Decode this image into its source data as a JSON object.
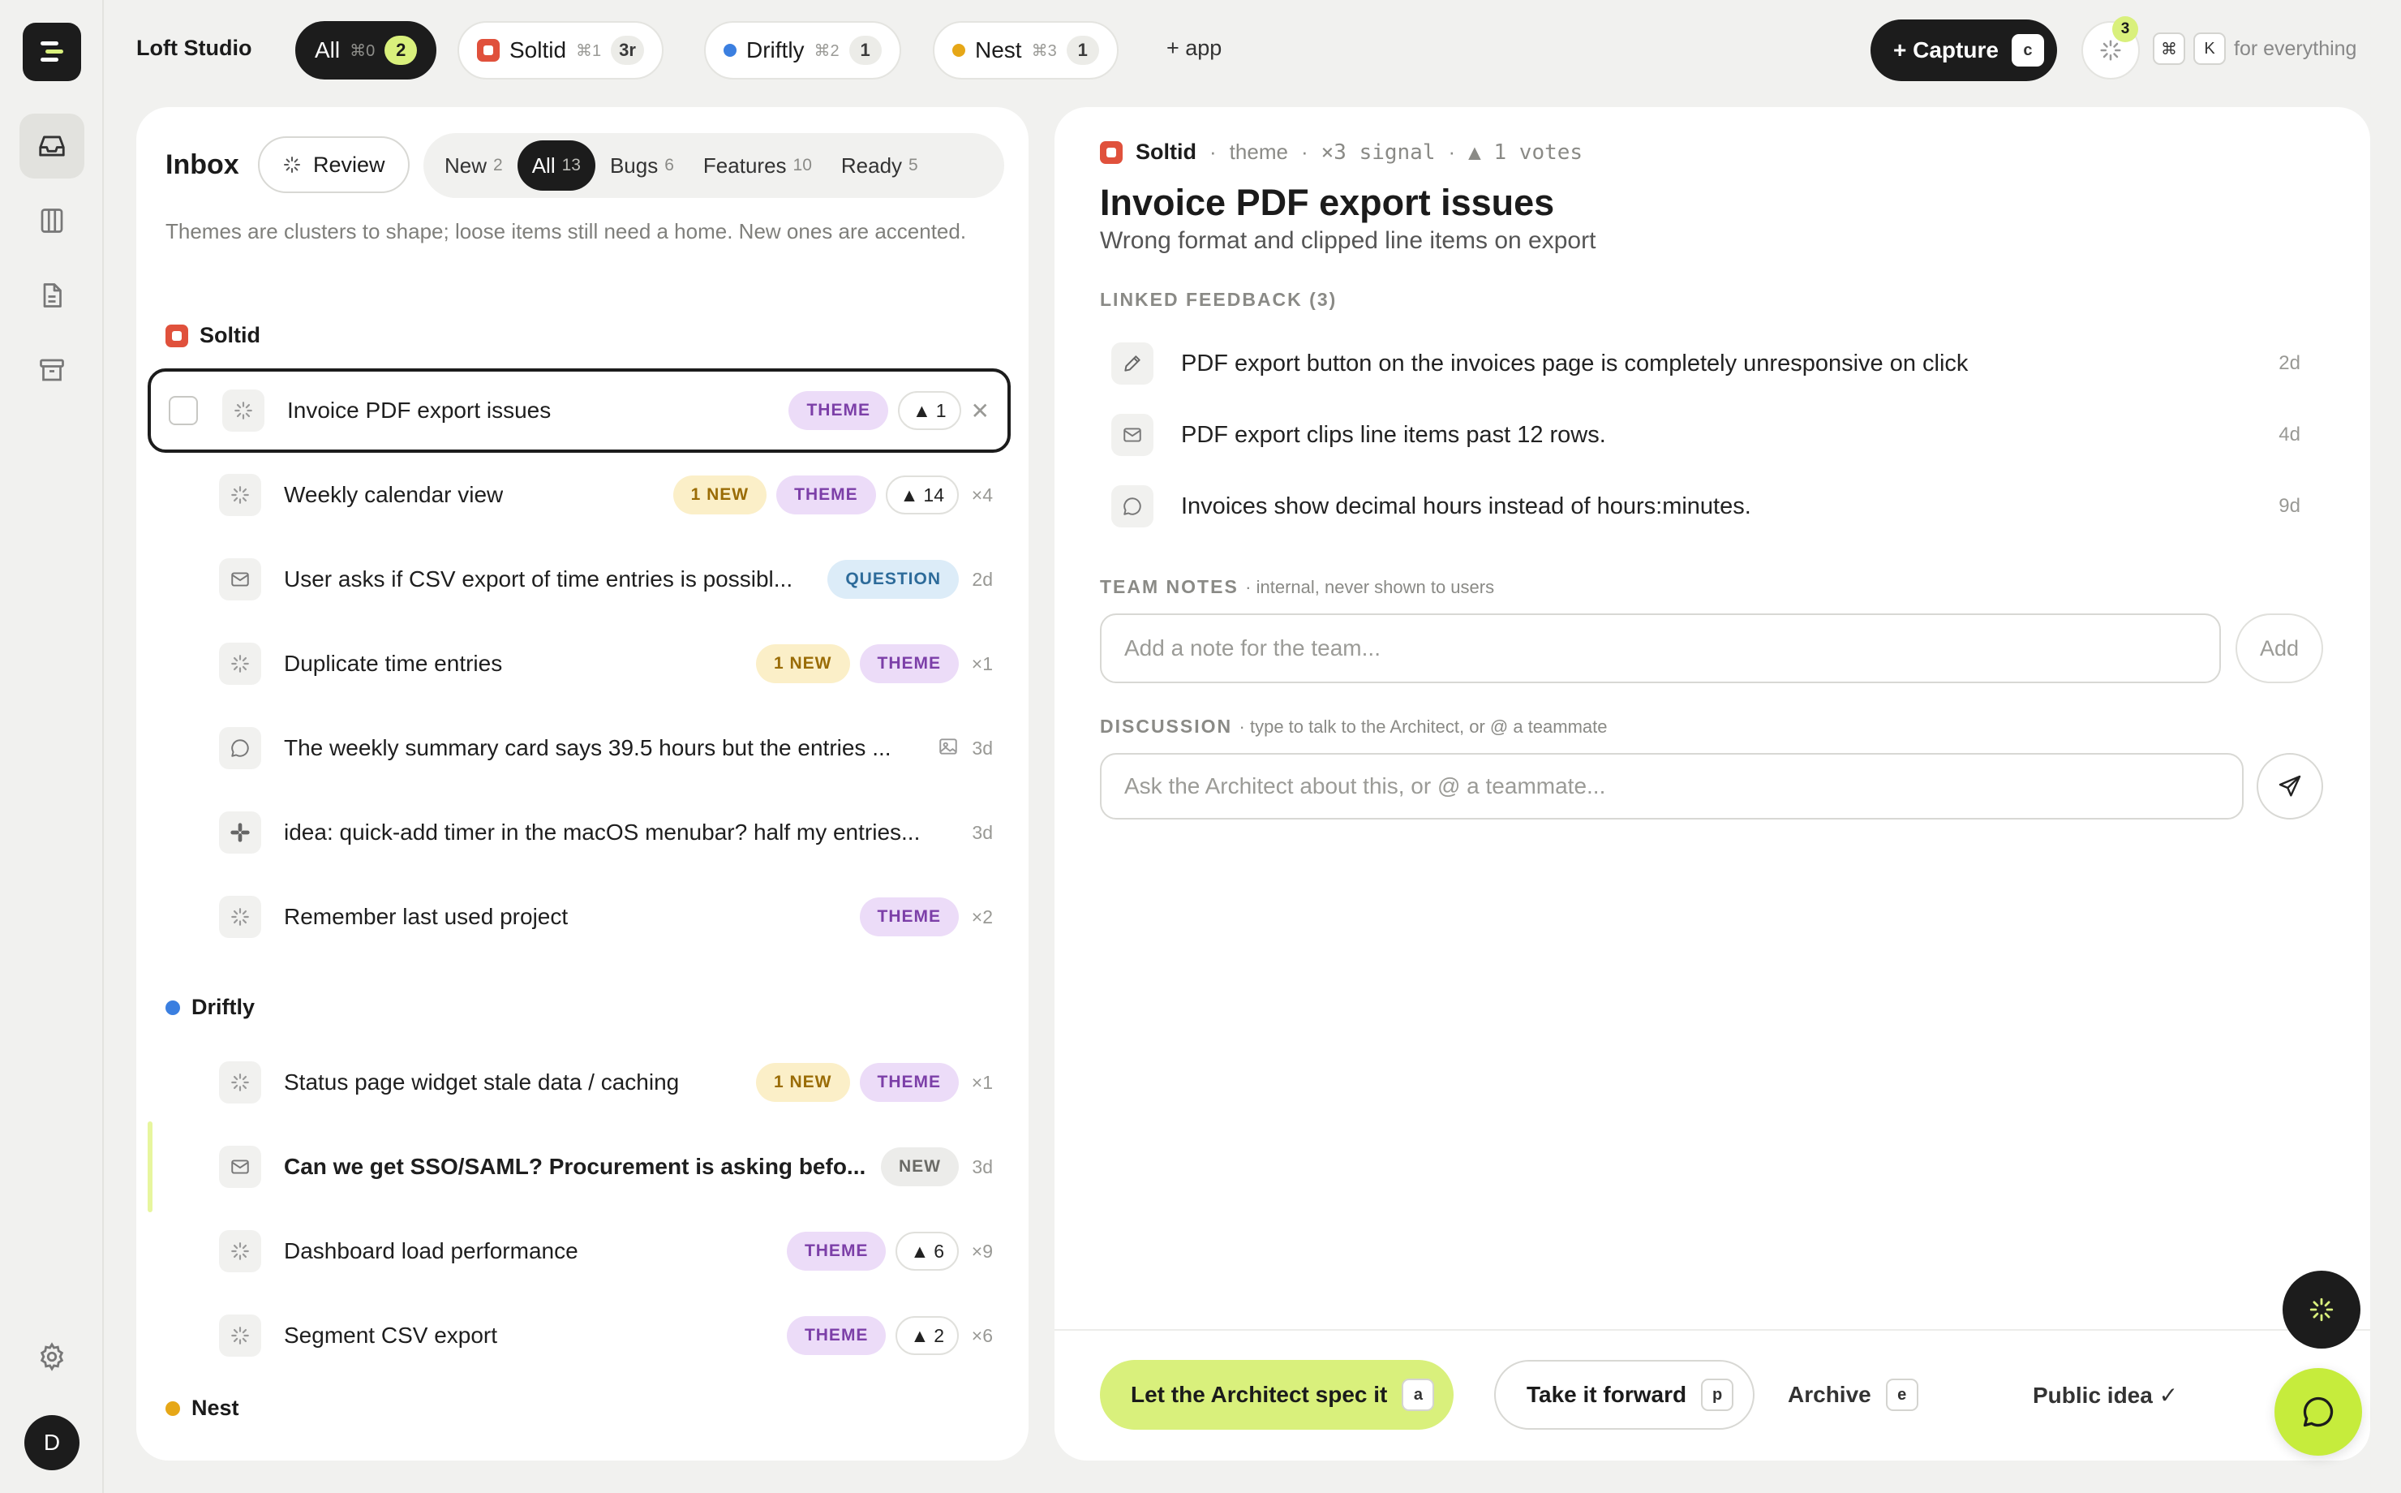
{
  "app": {
    "workspace": "Loft Studio"
  },
  "topbar": {
    "apps": [
      {
        "label": "All",
        "shortcut": "⌘0",
        "count": "2"
      },
      {
        "label": "Soltid",
        "shortcut": "⌘1",
        "count": "3r",
        "color": "#e0513c"
      },
      {
        "label": "Driftly",
        "shortcut": "⌘2",
        "count": "1",
        "color": "#3b7fe0"
      },
      {
        "label": "Nest",
        "shortcut": "⌘3",
        "count": "1",
        "color": "#e6a717"
      }
    ],
    "add_app": "+ app",
    "capture_label": "+ Capture",
    "capture_key": "c",
    "activity_count": "3",
    "cmd_key": "⌘",
    "k_key": "K",
    "cmd_hint": "for everything"
  },
  "sidebar": {
    "items": [
      {
        "icon": "inbox-icon"
      },
      {
        "icon": "board-icon"
      },
      {
        "icon": "document-icon"
      },
      {
        "icon": "archive-icon"
      }
    ],
    "settings_icon": "gear-icon",
    "avatar_initial": "D"
  },
  "inbox": {
    "title": "Inbox",
    "review_label": "Review",
    "filters": [
      {
        "label": "New",
        "count": "2"
      },
      {
        "label": "All",
        "count": "13"
      },
      {
        "label": "Bugs",
        "count": "6"
      },
      {
        "label": "Features",
        "count": "10"
      },
      {
        "label": "Ready",
        "count": "5"
      }
    ],
    "description": "Themes are clusters to shape; loose items still need a home. New ones are accented.",
    "groups": [
      {
        "name": "Soltid",
        "color": "#e0513c"
      },
      {
        "name": "Driftly",
        "color": "#3b7fe0"
      },
      {
        "name": "Nest",
        "color": "#e6a717"
      }
    ],
    "rows": [
      {
        "title": "Invoice PDF export issues",
        "tag": "THEME",
        "votes": "1"
      },
      {
        "title": "Weekly calendar view",
        "new": "1 NEW",
        "tag": "THEME",
        "votes": "14",
        "meta": "×4"
      },
      {
        "title": "User asks if CSV export of time entries is possibl...",
        "tag": "QUESTION",
        "meta": "2d"
      },
      {
        "title": "Duplicate time entries",
        "new": "1 NEW",
        "tag": "THEME",
        "meta": "×1"
      },
      {
        "title": "The weekly summary card says 39.5 hours but the entries ...",
        "meta": "3d"
      },
      {
        "title": "idea: quick-add timer in the macOS menubar? half my entries...",
        "meta": "3d"
      },
      {
        "title": "Remember last used project",
        "tag": "THEME",
        "meta": "×2"
      },
      {
        "title": "Status page widget stale data / caching",
        "new": "1 NEW",
        "tag": "THEME",
        "meta": "×1"
      },
      {
        "title": "Can we get SSO/SAML? Procurement is asking befo...",
        "tag": "NEW",
        "meta": "3d"
      },
      {
        "title": "Dashboard load performance",
        "tag": "THEME",
        "votes": "6",
        "meta": "×9"
      },
      {
        "title": "Segment CSV export",
        "tag": "THEME",
        "votes": "2",
        "meta": "×6"
      }
    ]
  },
  "detail": {
    "app": "Soltid",
    "kind": "theme",
    "signal": "×3 signal",
    "votes": "▲ 1 votes",
    "title": "Invoice PDF export issues",
    "subtitle": "Wrong format and clipped line items on export",
    "linked_label": "LINKED FEEDBACK (3)",
    "linked": [
      {
        "icon": "pencil-icon",
        "text": "PDF export button on the invoices page is completely unresponsive on click",
        "age": "2d"
      },
      {
        "icon": "mail-icon",
        "text": "PDF export clips line items past 12 rows.",
        "age": "4d"
      },
      {
        "icon": "chat-icon",
        "text": "Invoices show decimal hours instead of hours:minutes.",
        "age": "9d"
      }
    ],
    "notes_label": "TEAM NOTES",
    "notes_hint": "· internal, never shown to users",
    "notes_placeholder": "Add a note for the team...",
    "notes_add": "Add",
    "discussion_label": "DISCUSSION",
    "discussion_hint": "· type to talk to the Architect, or @ a teammate",
    "discussion_placeholder": "Ask the Architect about this, or @ a teammate...",
    "actions": {
      "spec_label": "Let the Architect spec it",
      "spec_key": "a",
      "forward_label": "Take it forward",
      "forward_key": "p",
      "archive_label": "Archive",
      "archive_key": "e",
      "public_label": "Public idea ✓"
    }
  },
  "colors": {
    "accent_lime": "#d9f07c",
    "dark": "#1c1c1c",
    "theme_purple": "#7c3fa8"
  }
}
